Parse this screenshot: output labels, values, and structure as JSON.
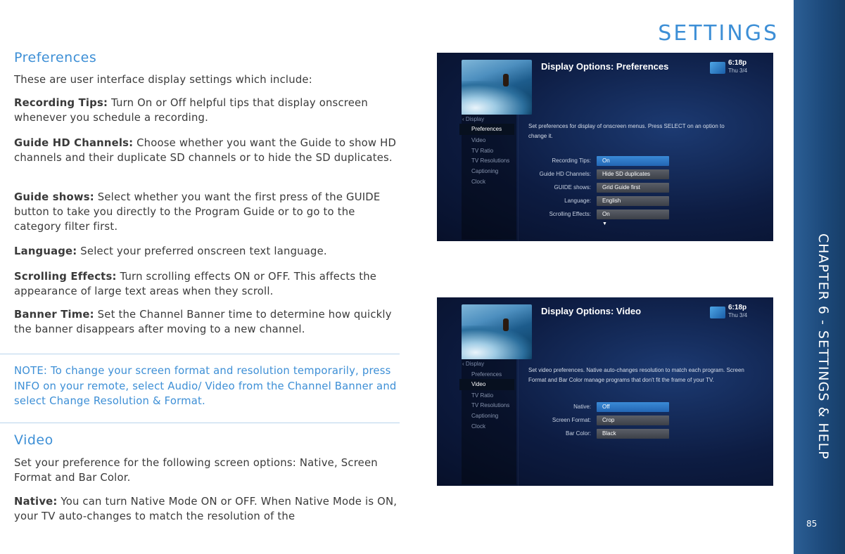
{
  "header": {
    "section_title": "SETTINGS"
  },
  "sidebar": {
    "chapter_label": "CHAPTER 6 - SETTINGS & HELP",
    "page_number": "85"
  },
  "preferences": {
    "heading": "Preferences",
    "intro": "These are user interface display settings which include:",
    "items": [
      {
        "term": "Recording Tips:",
        "text": " Turn On or Off helpful tips that display onscreen whenever you schedule a recording."
      },
      {
        "term": "Guide HD Channels:",
        "text": " Choose whether you want the Guide to show HD channels and their duplicate SD channels or to hide the SD duplicates."
      },
      {
        "term": "Guide shows:",
        "text": " Select whether you want the first press of the GUIDE button to take you directly to the Program Guide or to go to the category filter first."
      },
      {
        "term": "Language:",
        "text": " Select your preferred onscreen text language."
      },
      {
        "term": "Scrolling Effects:",
        "text": " Turn scrolling effects ON or OFF. This affects the appearance of large text areas when they scroll."
      },
      {
        "term": "Banner Time:",
        "text": " Set the Channel Banner time to determine how quickly the banner disappears after moving to a new channel."
      }
    ]
  },
  "note": "NOTE: To change your screen format and resolution temporarily, press INFO on your remote, select Audio/ Video from the Channel Banner and select Change Resolution & Format.",
  "video": {
    "heading": "Video",
    "intro": "Set your preference for the following screen options:  Native, Screen Format and Bar Color.",
    "native_term": "Native:",
    "native_text": " You can turn Native Mode ON or OFF. When Native Mode is ON, your TV auto-changes to match the resolution of the"
  },
  "screen1": {
    "title": "Display Options: Preferences",
    "time": "6:18p",
    "date": "Thu 3/4",
    "back": "Display",
    "menu": [
      "Preferences",
      "Video",
      "TV Ratio",
      "TV Resolutions",
      "Captioning",
      "Clock"
    ],
    "description": "Set preferences for display of onscreen menus. Press SELECT on an option to change it.",
    "rows": [
      {
        "label": "Recording Tips:",
        "value": "On"
      },
      {
        "label": "Guide HD Channels:",
        "value": "Hide SD duplicates"
      },
      {
        "label": "GUIDE shows:",
        "value": "Grid Guide first"
      },
      {
        "label": "Language:",
        "value": "English"
      },
      {
        "label": "Scrolling Effects:",
        "value": "On"
      }
    ],
    "more_arrow": "▼"
  },
  "screen2": {
    "title": "Display Options: Video",
    "time": "6:18p",
    "date": "Thu 3/4",
    "back": "Display",
    "menu": [
      "Preferences",
      "Video",
      "TV Ratio",
      "TV Resolutions",
      "Captioning",
      "Clock"
    ],
    "description": "Set video preferences. Native auto-changes resolution to match each program. Screen Format and Bar Color manage programs that don't fit the frame of your TV.",
    "rows": [
      {
        "label": "Native:",
        "value": "Off"
      },
      {
        "label": "Screen Format:",
        "value": "Crop"
      },
      {
        "label": "Bar Color:",
        "value": "Black"
      }
    ]
  },
  "colors": {
    "accent": "#3d8fd6",
    "sidebar": "#1d4a7c",
    "text": "#3a3a3a"
  }
}
